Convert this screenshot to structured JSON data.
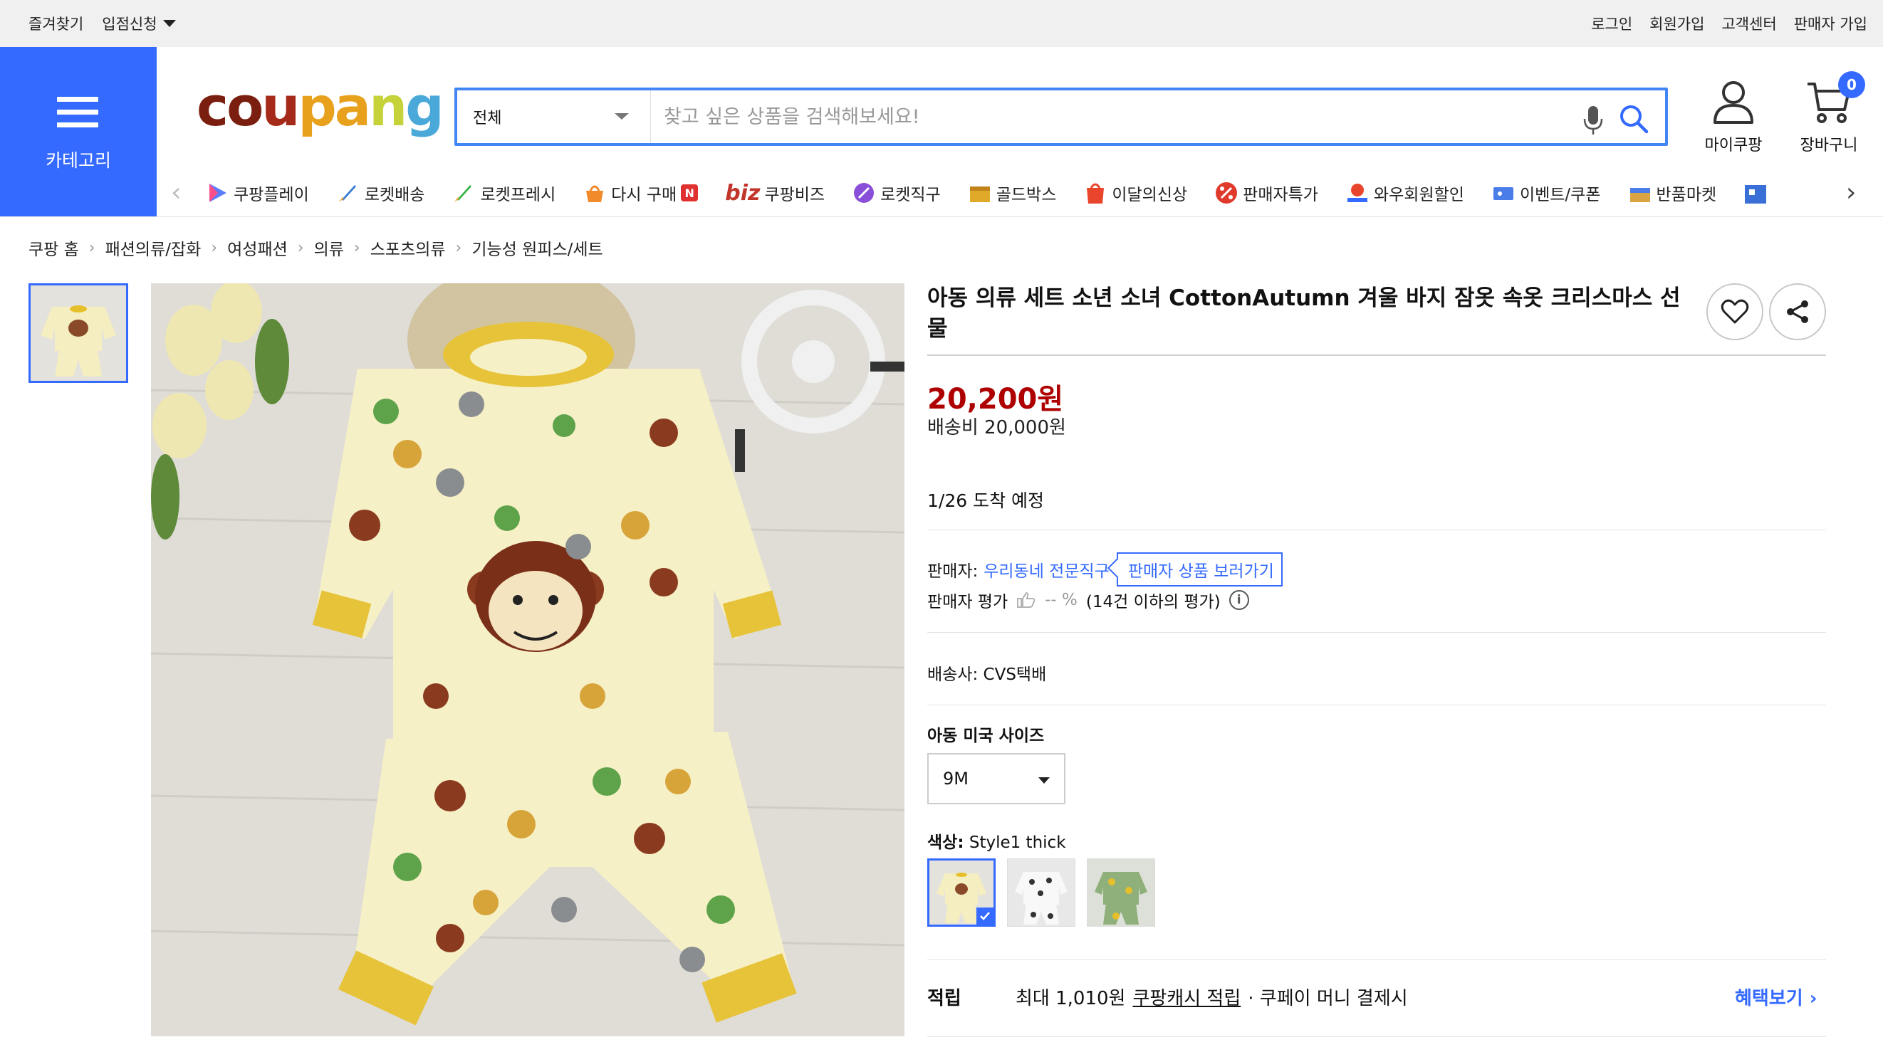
{
  "topbar": {
    "bookmark": "즐겨찾기",
    "apply": "입점신청",
    "login": "로그인",
    "signup": "회원가입",
    "support": "고객센터",
    "seller_join": "판매자 가입"
  },
  "header": {
    "category_label": "카테고리",
    "logo": {
      "c": "c",
      "o": "o",
      "u": "u",
      "p": "p",
      "a": "a",
      "n": "n",
      "g": "g"
    },
    "search": {
      "category": "전체",
      "placeholder": "찾고 싶은 상품을 검색해보세요!"
    },
    "mycoupang": "마이쿠팡",
    "cart": "장바구니",
    "cart_count": "0"
  },
  "nav": {
    "items": [
      {
        "label": "쿠팡플레이",
        "icon": "play-icon"
      },
      {
        "label": "로켓배송",
        "icon": "rocket-icon"
      },
      {
        "label": "로켓프레시",
        "icon": "rocket-fresh-icon"
      },
      {
        "label": "다시 구매",
        "icon": "rebuy-icon",
        "badge": "N"
      },
      {
        "label": "쿠팡비즈",
        "prefix": "biz"
      },
      {
        "label": "로켓직구",
        "icon": "global-icon"
      },
      {
        "label": "골드박스",
        "icon": "goldbox-icon"
      },
      {
        "label": "이달의신상",
        "icon": "new-icon"
      },
      {
        "label": "판매자특가",
        "icon": "percent-icon"
      },
      {
        "label": "와우회원할인",
        "icon": "wow-icon"
      },
      {
        "label": "이벤트/쿠폰",
        "icon": "coupon-icon"
      },
      {
        "label": "반품마켓",
        "icon": "return-market-icon"
      }
    ]
  },
  "breadcrumb": [
    "쿠팡 홈",
    "패션의류/잡화",
    "여성패션",
    "의류",
    "스포츠의류",
    "기능성 원피스/세트"
  ],
  "product": {
    "title": "아동 의류 세트 소년 소녀 CottonAutumn 겨울 바지 잠옷 속옷 크리스마스 선물",
    "price": "20,200원",
    "shipping_fee": "배송비 20,000원",
    "arrival": "1/26 도착 예정",
    "seller_label": "판매자:",
    "seller_name": "우리동네 전문직구",
    "seller_button": "판매자 상품 보러가기",
    "seller_rating_label": "판매자 평가",
    "seller_rating_value": "-- %",
    "seller_rating_count": "(14건 이하의 평가)",
    "carrier": "배송사:  CVS택배",
    "size_label": "아동 미국 사이즈",
    "size_value": "9M",
    "color_label": "색상:",
    "color_value": "Style1 thick",
    "reward_label": "적립",
    "reward_max": "최대 1,010원",
    "reward_cash": "쿠팡캐시 적립",
    "reward_note": "· 쿠페이 머니 결제시",
    "benefit_link": "혜택보기 ›"
  },
  "colors": {
    "accent": "#346aff",
    "price": "#ae0000",
    "search_border": "#4285f4"
  }
}
